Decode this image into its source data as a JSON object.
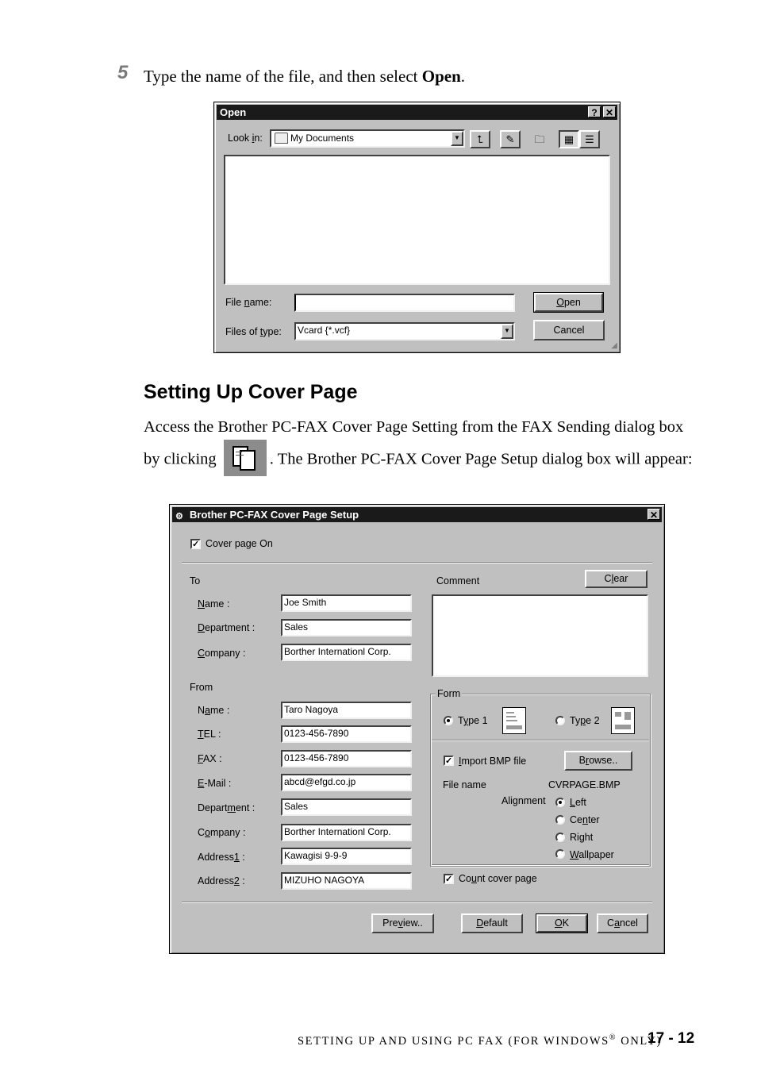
{
  "step": {
    "number": "5",
    "text_before": "Type the name of the file, and then select ",
    "text_bold": "Open",
    "text_after": "."
  },
  "open_dialog": {
    "title": "Open",
    "help_glyph": "?",
    "close_glyph": "✕",
    "look_in_label": "Look in:",
    "look_in_value": "My Documents",
    "look_in_icon": "folder-icon",
    "toolbar": [
      "up-one-level-icon",
      "favorites-icon",
      "new-folder-icon",
      "list-view-icon",
      "details-view-icon"
    ],
    "file_name_label": "File name:",
    "file_name_value": "",
    "files_of_type_label": "Files of type:",
    "files_of_type_value": "Vcard {*.vcf}",
    "open_button": "Open",
    "cancel_button": "Cancel"
  },
  "section": {
    "heading": "Setting Up Cover Page",
    "para_part1": "Access the Brother PC-FAX Cover Page Setting from the FAX Sending dialog box by clicking",
    "para_icon": "cover-page-icon",
    "para_part2": ". The Brother PC-FAX Cover Page Setup dialog box will appear:"
  },
  "cover_dialog": {
    "title": "Brother PC-FAX Cover Page Setup",
    "close_glyph": "✕",
    "cover_page_on": {
      "label": "Cover page On",
      "checked": true
    },
    "to": {
      "heading": "To",
      "fields": [
        {
          "label": "Name :",
          "value": "Joe Smith"
        },
        {
          "label": "Department :",
          "value": "Sales"
        },
        {
          "label": "Company :",
          "value": "Borther Internationl Corp."
        }
      ]
    },
    "from": {
      "heading": "From",
      "fields": [
        {
          "label": "Name :",
          "value": "Taro Nagoya"
        },
        {
          "label": "TEL :",
          "value": "0123-456-7890"
        },
        {
          "label": "FAX :",
          "value": "0123-456-7890"
        },
        {
          "label": "E-Mail :",
          "value": "abcd@efgd.co.jp"
        },
        {
          "label": "Department :",
          "value": "Sales"
        },
        {
          "label": "Company :",
          "value": "Borther Internationl Corp."
        },
        {
          "label": "Address1 :",
          "value": "Kawagisi 9-9-9"
        },
        {
          "label": "Address2 :",
          "value": "MIZUHO NAGOYA"
        }
      ]
    },
    "comment": {
      "label": "Comment",
      "value": "",
      "clear_button": "Clear"
    },
    "form": {
      "legend": "Form",
      "type1_label": "Type 1",
      "type2_label": "Type 2",
      "selected": "Type 1"
    },
    "import_bmp": {
      "label": "Import BMP file",
      "checked": true,
      "browse_button": "Browse.."
    },
    "file_name_label": "File name",
    "file_name_value": "CVRPAGE.BMP",
    "alignment": {
      "label": "Alignment",
      "options": [
        "Left",
        "Center",
        "Right",
        "Wallpaper"
      ],
      "selected": "Left"
    },
    "count_cover_page": {
      "label": "Count cover page",
      "checked": true
    },
    "buttons": {
      "preview": "Preview..",
      "default": "Default",
      "ok": "OK",
      "cancel": "Cancel"
    }
  },
  "footer": {
    "running_title": "SETTING UP AND USING PC FAX (FOR WINDOWS",
    "registered": "®",
    "running_title_end": " ONLY)",
    "page_number": "17 - 12"
  }
}
